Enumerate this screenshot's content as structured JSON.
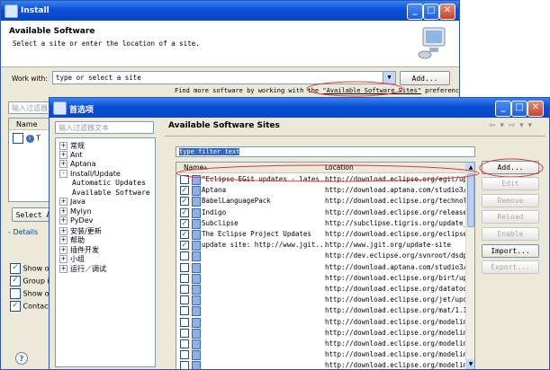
{
  "install": {
    "title": "Install",
    "heading": "Available Software",
    "subheading": "Select a site or enter the location of a site.",
    "work_with_label": "Work with:",
    "work_with_value": "type or select a site",
    "add_button": "Add...",
    "find_more_prefix": "Find more software by working with the ",
    "find_more_link": "\"Available Software Sites\"",
    "find_more_suffix": " preferences.",
    "filter_placeholder": "输入过滤器文本",
    "name_header": "Name",
    "tree_row_label": "T",
    "select_all_button": "Select A",
    "details_label": "Details",
    "options": [
      {
        "label": "Show onl",
        "checked": true
      },
      {
        "label": "Group ite",
        "checked": true
      },
      {
        "label": "Show only",
        "checked": false
      },
      {
        "label": "Contact",
        "checked": true
      }
    ],
    "help_glyph": "?"
  },
  "prefs": {
    "title": "首选项",
    "filter_placeholder": "输入过滤器文本",
    "tree": [
      {
        "label": "常规",
        "expander": "+",
        "indent": 0
      },
      {
        "label": "Ant",
        "expander": "+",
        "indent": 0
      },
      {
        "label": "Aptana",
        "expander": "+",
        "indent": 0
      },
      {
        "label": "Install/Update",
        "expander": "-",
        "indent": 0
      },
      {
        "label": "Automatic Updates",
        "expander": "",
        "indent": 1
      },
      {
        "label": "Available Software Si",
        "expander": "",
        "indent": 1
      },
      {
        "label": "Java",
        "expander": "+",
        "indent": 0
      },
      {
        "label": "Mylyn",
        "expander": "+",
        "indent": 0
      },
      {
        "label": "PyDev",
        "expander": "+",
        "indent": 0
      },
      {
        "label": "安装/更新",
        "expander": "+",
        "indent": 0
      },
      {
        "label": "帮助",
        "expander": "+",
        "indent": 0
      },
      {
        "label": "插件开发",
        "expander": "+",
        "indent": 0
      },
      {
        "label": "小组",
        "expander": "+",
        "indent": 0
      },
      {
        "label": "运行／调试",
        "expander": "+",
        "indent": 0
      }
    ],
    "page_title": "Available Software Sites",
    "nav_icons": "⇦ ▾ ⇨ ▾ ▾",
    "filter_text": "type filter text",
    "col_name": "Name",
    "col_location": "Location",
    "sites": [
      {
        "name": "\"Eclipse EGit updates - lates...",
        "location": "http://download.eclipse.org/egit/updates",
        "checked": false
      },
      {
        "name": "Aptana",
        "location": "http://download.aptana.com/studio3/plug",
        "checked": true
      },
      {
        "name": "BabelLanguagePack",
        "location": "http://download.eclipse.org/technology/b",
        "checked": true
      },
      {
        "name": "Indigo",
        "location": "http://download.eclipse.org/releases/in",
        "checked": true
      },
      {
        "name": "Subclipse",
        "location": "http://subclipse.tigris.org/update_1.6.",
        "checked": true
      },
      {
        "name": "The Eclipse Project Updates",
        "location": "http://download.eclipse.org/eclipse/upd",
        "checked": true
      },
      {
        "name": "update site: http://www.jgit...",
        "location": "http://www.jgit.org/update-site",
        "checked": true
      },
      {
        "name": "",
        "location": "http://dev.eclipse.org/svnroot/dsdp/org",
        "checked": false
      },
      {
        "name": "",
        "location": "http://download.aptana.com/studio3/plug",
        "checked": false
      },
      {
        "name": "",
        "location": "http://download.eclipse.org/birt/update",
        "checked": false
      },
      {
        "name": "",
        "location": "http://download.eclipse.org/datatools/u",
        "checked": false
      },
      {
        "name": "",
        "location": "http://download.eclipse.org/jet/update",
        "checked": false
      },
      {
        "name": "",
        "location": "http://download.eclipse.org/mat/1.1/upd",
        "checked": false
      },
      {
        "name": "",
        "location": "http://download.eclipse.org/modeling/em",
        "checked": false
      },
      {
        "name": "",
        "location": "http://download.eclipse.org/modeling/em",
        "checked": false
      },
      {
        "name": "",
        "location": "http://download.eclipse.org/modeling/em",
        "checked": false
      },
      {
        "name": "",
        "location": "http://download.eclipse.org/modeling/em",
        "checked": false
      },
      {
        "name": "",
        "location": "http://download.eclipse.org/modeling/em",
        "checked": false
      }
    ],
    "buttons": {
      "add": "Add...",
      "edit": "Edit",
      "remove": "Remove",
      "reload": "Reload",
      "enable": "Enable",
      "import": "Import...",
      "export": "Export..."
    },
    "window_buttons": {
      "minimize": "_",
      "maximize": "□",
      "close": "✕"
    }
  },
  "colors": {
    "xp_title": "#0a4fd6",
    "annotation": "#d83a3a",
    "check": "#1a8a1a"
  }
}
